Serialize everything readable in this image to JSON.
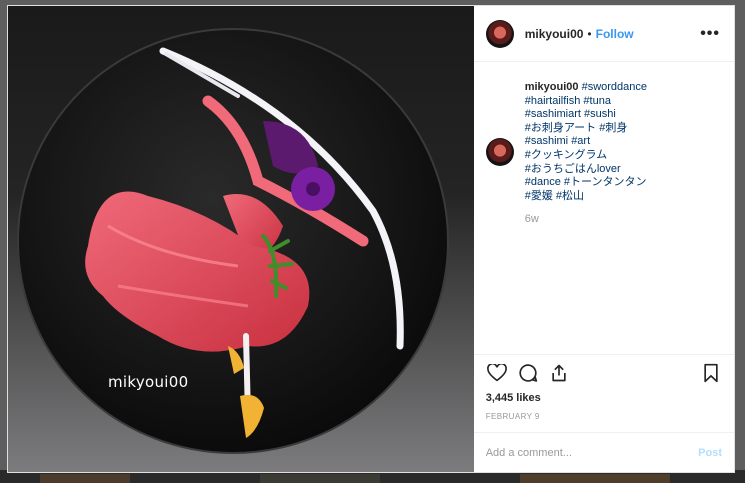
{
  "post": {
    "username": "mikyoui00",
    "follow_label": "Follow",
    "separator": "•",
    "more_label": "•••",
    "watermark": "mikyoui00"
  },
  "caption": {
    "username": "mikyoui00",
    "tags": [
      "#sworddance",
      "#hairtailfish",
      "#tuna",
      "#sashimiart",
      "#sushi",
      "#お刺身アート",
      "#刺身",
      "#sashimi",
      "#art",
      "#クッキングラム",
      "#おうちごはんlover",
      "#dance",
      "#トーンタンタン",
      "#愛媛",
      "#松山"
    ],
    "age": "6w"
  },
  "actions": {
    "icons": [
      "heart-icon",
      "comment-icon",
      "share-icon",
      "bookmark-icon"
    ],
    "likes": "3,445 likes",
    "date": "FEBRUARY 9"
  },
  "comment_box": {
    "placeholder": "Add a comment...",
    "post_label": "Post"
  },
  "colors": {
    "link": "#3897f0",
    "hashtag": "#003569",
    "post_disabled": "#b2dffc",
    "plate": "#161616",
    "tuna": "#e8485a",
    "petal": "#7b1fa2"
  }
}
